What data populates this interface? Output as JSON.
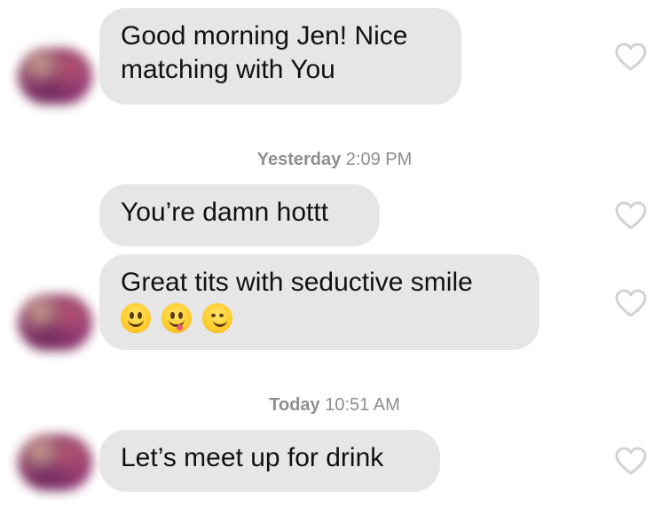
{
  "conversation": {
    "messages": [
      {
        "text_lines": [
          "Good morning Jen! Nice",
          "matching with You"
        ]
      },
      {
        "text_lines": [
          "You’re damn hottt"
        ]
      },
      {
        "text_lines": [
          "Great tits with seductive smile"
        ],
        "emojis": [
          "grinning-face",
          "face-savoring-food",
          "smirking-face"
        ]
      },
      {
        "text_lines": [
          "Let’s meet up for drink"
        ]
      }
    ],
    "timestamps": [
      {
        "day": "Yesterday",
        "time": "2:09 PM"
      },
      {
        "day": "Today",
        "time": "10:51 AM"
      }
    ]
  },
  "colors": {
    "bubble_background": "#e6e6e6",
    "timestamp_text": "#8e8e93",
    "heart_outline": "#d3d3d3"
  },
  "icons": {
    "like": "heart-outline-icon",
    "avatar": "blurred-avatar"
  }
}
